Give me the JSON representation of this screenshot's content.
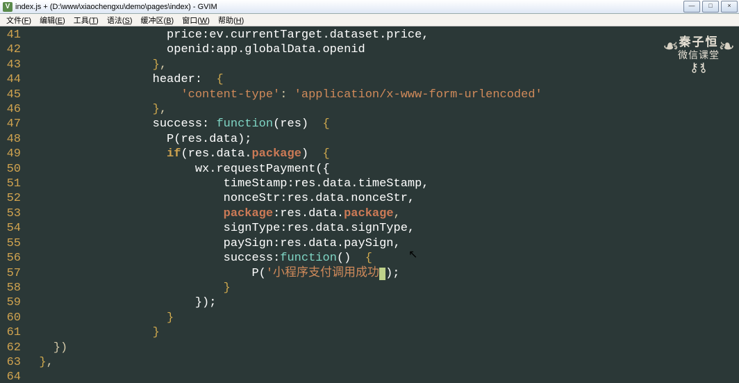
{
  "window": {
    "title": "index.js + (D:\\www\\xiaochengxu\\demo\\pages\\index) - GVIM",
    "btn_min": "—",
    "btn_max": "□",
    "btn_close": "×"
  },
  "menu": {
    "file": {
      "cn": "文件",
      "u": "F"
    },
    "edit": {
      "cn": "编辑",
      "u": "E"
    },
    "tools": {
      "cn": "工具",
      "u": "T"
    },
    "syntax": {
      "cn": "语法",
      "u": "S"
    },
    "buffers": {
      "cn": "缓冲区",
      "u": "B"
    },
    "window": {
      "cn": "窗口",
      "u": "W"
    },
    "help": {
      "cn": "帮助",
      "u": "H"
    }
  },
  "lines": {
    "start": 41,
    "end": 64
  },
  "code": {
    "l41_price": "price:ev.currentTarget.dataset.price,",
    "l42_openid": "openid:app.globalData.openid",
    "l44_header": "header:",
    "l45_ctype_key": "'content-type'",
    "l45_ctype_val": "'application/x-www-form-urlencoded'",
    "l47_success": "success: ",
    "l47_func": "function",
    "l47_args": "(res)",
    "l48_p": "P(res.data);",
    "l49_if": "if",
    "l49_cond_a": "(res.data.",
    "l49_pkg": "package",
    "l49_cond_b": ")",
    "l50_wxreq": "wx.requestPayment({",
    "l51_ts": "timeStamp:res.data.timeStamp,",
    "l52_ns": "nonceStr:res.data.nonceStr,",
    "l53_pkg": "package",
    "l53_pkg_b": ":res.data.",
    "l53_pkg_c": "package",
    "l54_st": "signType:res.data.signType,",
    "l55_ps": "paySign:res.data.paySign,",
    "l56_succ": "success:",
    "l56_func": "function",
    "l56_args": "()",
    "l57_p": "P(",
    "l57_str": "'小程序支付调用成功",
    "l57_end": ");",
    "l59_close": "});"
  },
  "watermark": {
    "line1": "秦子恒",
    "line2": "微信课堂",
    "keys": "✕"
  }
}
